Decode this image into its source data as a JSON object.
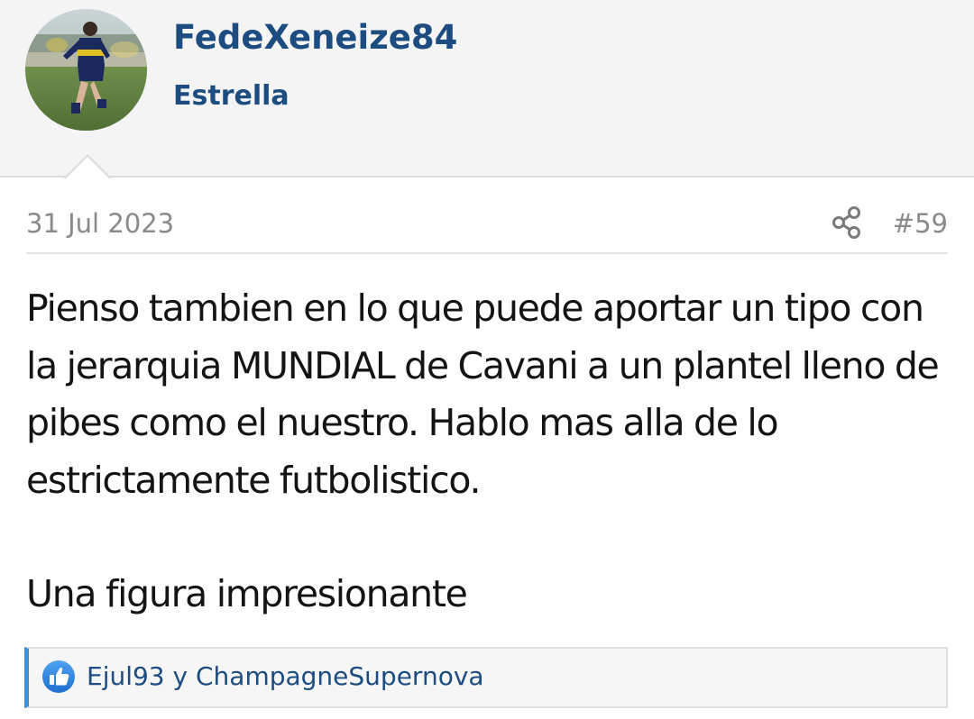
{
  "user": {
    "name": "FedeXeneize84",
    "title": "Estrella",
    "avatar_icon": "player-photo-avatar"
  },
  "post": {
    "date": "31 Jul 2023",
    "number": "#59",
    "share_icon": "share-icon",
    "paragraphs": [
      "Pienso tambien en lo que puede aportar un tipo con la jerarquia MUNDIAL de Cavani a un plantel lleno de pibes como el nuestro. Hablo mas alla de lo estrictamente futbolistico.",
      "Una figura impresionante"
    ]
  },
  "reactions": {
    "icon": "like-icon",
    "users": [
      "Ejul93",
      "ChampagneSupernova"
    ],
    "joiner": " y "
  },
  "colors": {
    "link": "#1c4c80",
    "muted": "#8a8a8a",
    "accent": "#3f8fd6",
    "header_bg": "#f4f4f4"
  }
}
